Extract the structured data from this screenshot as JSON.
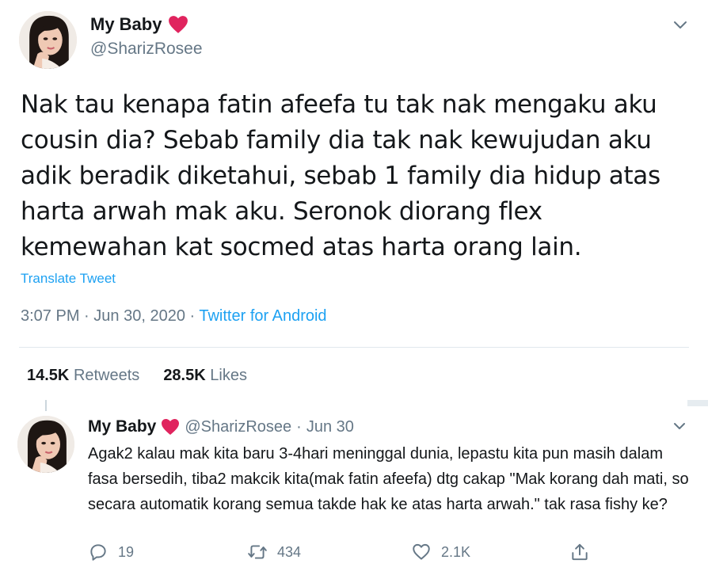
{
  "main_tweet": {
    "display_name": "My Baby",
    "name_emoji": "red-heart-icon",
    "handle": "@SharizRosee",
    "text": "Nak tau kenapa fatin afeefa tu tak nak mengaku aku cousin dia? Sebab family dia tak nak kewujudan aku adik beradik diketahui, sebab 1 family dia hidup atas harta arwah mak aku. Seronok diorang flex kemewahan kat socmed atas harta orang lain.",
    "translate_label": "Translate Tweet",
    "time": "3:07 PM",
    "date": "Jun 30, 2020",
    "separator": "·",
    "source": "Twitter for Android",
    "retweets_count": "14.5K",
    "retweets_label": "Retweets",
    "likes_count": "28.5K",
    "likes_label": "Likes"
  },
  "reply_tweet": {
    "display_name": "My Baby",
    "name_emoji": "red-heart-icon",
    "handle": "@SharizRosee",
    "separator": "·",
    "date": "Jun 30",
    "text": "Agak2 kalau mak kita baru 3-4hari meninggal dunia, lepastu kita pun masih dalam fasa bersedih, tiba2 makcik kita(mak fatin afeefa) dtg cakap \"Mak korang dah mati, so secara automatik korang semua takde hak ke atas harta arwah.\" tak rasa fishy ke?",
    "reply_count": "19",
    "retweet_count": "434",
    "like_count": "2.1K"
  },
  "colors": {
    "text": "#14171a",
    "muted": "#657786",
    "link": "#1da1f2",
    "heart": "#e0245e",
    "divider": "#e1e8ed"
  }
}
